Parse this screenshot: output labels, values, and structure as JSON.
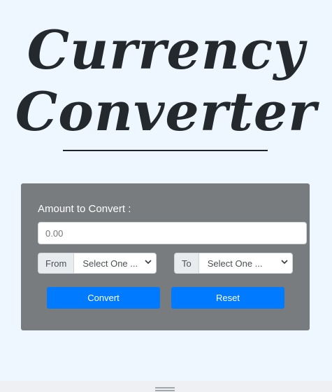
{
  "app": {
    "title_line1": "Currency",
    "title_line2": "Converter"
  },
  "form": {
    "amount_label": "Amount to Convert :",
    "amount_placeholder": "0.00",
    "from_label": "From",
    "from_selected": "Select One ...",
    "to_label": "To",
    "to_selected": "Select One ...",
    "convert_label": "Convert",
    "reset_label": "Reset"
  },
  "colors": {
    "page_bg": "#eef6ff",
    "card_bg": "#787c7f",
    "button_primary": "#007bff"
  }
}
